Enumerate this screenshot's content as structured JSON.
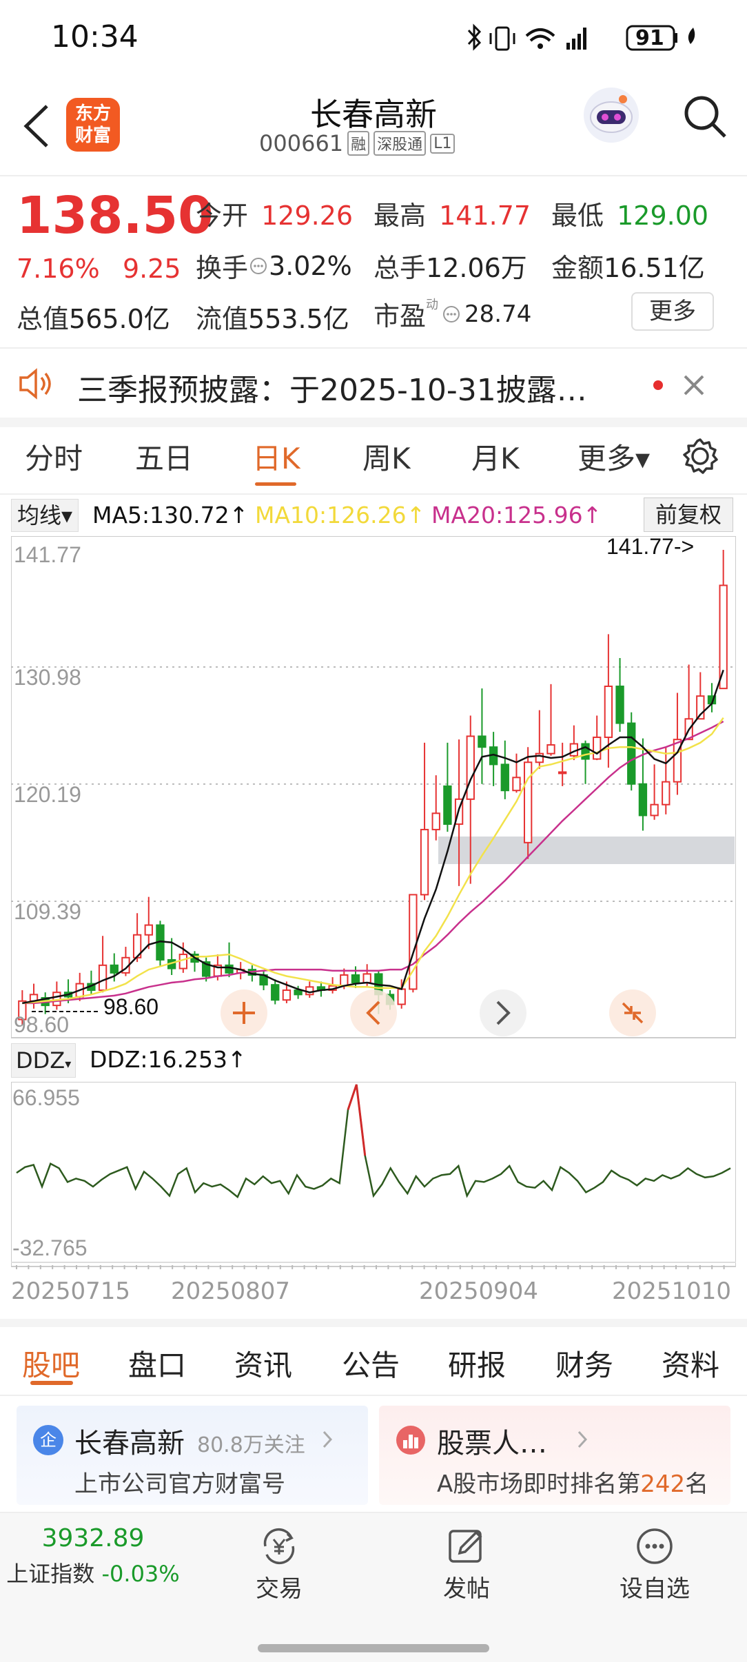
{
  "status_bar": {
    "time": "10:34",
    "battery": "91"
  },
  "header": {
    "logo_line1": "东方",
    "logo_line2": "财富",
    "title": "长春高新",
    "code": "000661",
    "tags": [
      "融",
      "深股通",
      "L1"
    ]
  },
  "quote": {
    "price": "138.50",
    "change_pct": "7.16%",
    "change_amt": "9.25",
    "open_label": "今开",
    "open": "129.26",
    "high_label": "最高",
    "high": "141.77",
    "low_label": "最低",
    "low": "129.00",
    "turnover_label": "换手",
    "turnover": "3.02%",
    "volume_label": "总手",
    "volume": "12.06万",
    "amount_label": "金额",
    "amount": "16.51亿",
    "mktcap_label": "总值",
    "mktcap": "565.0亿",
    "float_label": "流值",
    "float": "553.5亿",
    "pe_label": "市盈",
    "pe_sup": "动",
    "pe": "28.74",
    "more_label": "更多"
  },
  "notice": {
    "text": "三季报预披露：于2025-10-31披露…"
  },
  "period_tabs": [
    "分时",
    "五日",
    "日K",
    "周K",
    "月K",
    "更多▾"
  ],
  "active_period": "日K",
  "ma_bar": {
    "selector": "均线▾",
    "ma5": "MA5:130.72↑",
    "ma10": "MA10:126.26↑",
    "ma20": "MA20:125.96↑",
    "adjust": "前复权"
  },
  "colors": {
    "up": "#e63232",
    "down": "#1a9a2a",
    "ma5": "#111111",
    "ma10": "#f2e24a",
    "ma20": "#c8308c",
    "accent": "#e0692a"
  },
  "chart_data": {
    "type": "candlestick",
    "y_ticks": [
      "141.77",
      "130.98",
      "120.19",
      "109.39",
      "98.60"
    ],
    "ylim": [
      98.6,
      141.77
    ],
    "max_label": "141.77->",
    "min_label": "98.60",
    "x_ticks": [
      "20250715",
      "20250807",
      "20250904",
      "20251010"
    ],
    "candles": [
      [
        98.5,
        100.2,
        101.2,
        98.0
      ],
      [
        100.2,
        100.8,
        101.8,
        99.5
      ],
      [
        100.5,
        99.8,
        101.0,
        99.0
      ],
      [
        99.8,
        101.0,
        102.0,
        99.4
      ],
      [
        101.0,
        100.6,
        102.2,
        100.0
      ],
      [
        100.6,
        101.8,
        102.8,
        100.2
      ],
      [
        101.8,
        101.2,
        103.0,
        100.8
      ],
      [
        101.2,
        103.5,
        106.2,
        101.0
      ],
      [
        103.5,
        102.8,
        104.6,
        102.0
      ],
      [
        102.8,
        104.2,
        105.2,
        102.5
      ],
      [
        104.2,
        106.3,
        108.3,
        103.8
      ],
      [
        106.3,
        107.2,
        109.8,
        105.0
      ],
      [
        107.2,
        104.0,
        107.6,
        103.4
      ],
      [
        104.0,
        103.2,
        106.0,
        102.6
      ],
      [
        103.2,
        104.5,
        105.6,
        102.8
      ],
      [
        104.5,
        103.8,
        104.8,
        102.9
      ],
      [
        103.8,
        102.5,
        104.2,
        102.0
      ],
      [
        102.5,
        103.5,
        104.5,
        102.1
      ],
      [
        103.5,
        102.8,
        105.6,
        102.4
      ],
      [
        102.8,
        103.1,
        103.8,
        102.2
      ],
      [
        103.1,
        102.6,
        103.5,
        102.0
      ],
      [
        102.6,
        101.7,
        103.0,
        101.2
      ],
      [
        101.7,
        100.3,
        102.2,
        99.9
      ],
      [
        100.3,
        101.2,
        102.0,
        100.0
      ],
      [
        101.2,
        100.8,
        101.6,
        100.4
      ],
      [
        100.8,
        101.5,
        102.0,
        100.5
      ],
      [
        101.5,
        101.2,
        102.0,
        100.6
      ],
      [
        101.2,
        101.6,
        102.4,
        100.9
      ],
      [
        101.6,
        102.6,
        103.2,
        101.3
      ],
      [
        102.6,
        101.9,
        103.4,
        101.4
      ],
      [
        101.9,
        102.7,
        103.6,
        101.6
      ],
      [
        102.7,
        100.8,
        103.0,
        99.0
      ],
      [
        100.8,
        99.9,
        101.2,
        99.4
      ],
      [
        99.9,
        101.3,
        102.2,
        99.5
      ],
      [
        101.3,
        110.0,
        110.0,
        101.0
      ],
      [
        110.0,
        116.0,
        124.0,
        109.5
      ],
      [
        116.0,
        117.5,
        121.0,
        115.0
      ],
      [
        120.0,
        116.5,
        124.0,
        115.8
      ],
      [
        116.5,
        118.8,
        124.3,
        110.8
      ],
      [
        118.8,
        124.6,
        126.5,
        111.0
      ],
      [
        124.6,
        123.6,
        129.0,
        120.2
      ],
      [
        123.6,
        122.0,
        125.0,
        120.0
      ],
      [
        122.0,
        119.6,
        124.2,
        118.8
      ],
      [
        119.6,
        120.8,
        123.0,
        119.4
      ],
      [
        114.8,
        122.2,
        123.6,
        113.3
      ],
      [
        122.2,
        123.0,
        127.0,
        121.6
      ],
      [
        123.0,
        123.8,
        129.4,
        122.8
      ],
      [
        121.3,
        121.3,
        124.0,
        120.0
      ],
      [
        122.8,
        123.9,
        125.6,
        122.4
      ],
      [
        123.9,
        122.5,
        124.2,
        120.2
      ],
      [
        122.5,
        124.5,
        126.5,
        122.4
      ],
      [
        124.5,
        129.2,
        134.0,
        121.7
      ],
      [
        129.2,
        125.8,
        131.8,
        125.0
      ],
      [
        125.8,
        120.2,
        126.8,
        119.6
      ],
      [
        120.2,
        117.3,
        124.4,
        115.9
      ],
      [
        117.3,
        118.3,
        122.0,
        116.9
      ],
      [
        118.3,
        120.4,
        123.6,
        117.4
      ],
      [
        120.4,
        124.3,
        128.6,
        119.2
      ],
      [
        124.3,
        126.2,
        131.2,
        124.4
      ],
      [
        126.2,
        128.3,
        130.5,
        127.1
      ],
      [
        128.3,
        127.6,
        129.5,
        126.8
      ],
      [
        129.0,
        138.5,
        141.77,
        129.0
      ]
    ],
    "ma5": [
      100.0,
      100.2,
      100.4,
      100.6,
      100.8,
      101.2,
      101.6,
      102.1,
      102.5,
      103.2,
      104.3,
      105.4,
      105.7,
      105.6,
      105.0,
      104.2,
      103.6,
      103.3,
      103.3,
      103.1,
      102.7,
      102.6,
      102.1,
      101.7,
      101.3,
      101.0,
      101.2,
      101.3,
      101.6,
      101.8,
      101.9,
      101.7,
      101.6,
      101.3,
      104.6,
      107.8,
      110.5,
      114.0,
      117.9,
      120.6,
      122.7,
      122.9,
      122.6,
      122.2,
      122.7,
      122.8,
      122.6,
      122.7,
      123.2,
      123.6,
      123.0,
      123.8,
      124.5,
      124.5,
      123.6,
      122.5,
      122.1,
      123.1,
      125.2,
      126.6,
      127.6,
      130.7
    ],
    "ma10": [
      100.0,
      100.1,
      100.2,
      100.3,
      100.4,
      100.6,
      100.8,
      101.1,
      101.4,
      101.8,
      102.5,
      103.1,
      103.4,
      103.7,
      104.0,
      104.3,
      104.3,
      104.4,
      104.5,
      104.1,
      103.6,
      103.2,
      102.8,
      102.5,
      102.3,
      102.1,
      101.9,
      101.7,
      101.6,
      101.5,
      101.5,
      101.4,
      101.4,
      101.4,
      103.0,
      104.8,
      106.2,
      108.0,
      110.0,
      111.9,
      113.6,
      115.2,
      116.9,
      118.6,
      120.7,
      121.8,
      122.0,
      122.3,
      122.6,
      122.9,
      123.1,
      123.5,
      123.6,
      123.6,
      123.4,
      123.2,
      123.0,
      123.1,
      123.5,
      124.0,
      124.8,
      126.3
    ],
    "ma20": [
      100.0,
      100.0,
      100.1,
      100.2,
      100.3,
      100.4,
      100.5,
      100.6,
      100.7,
      100.9,
      101.2,
      101.5,
      101.7,
      101.9,
      102.0,
      102.2,
      102.3,
      102.5,
      102.6,
      102.8,
      102.9,
      103.0,
      103.1,
      103.1,
      103.1,
      103.1,
      103.1,
      103.0,
      103.0,
      103.0,
      103.0,
      103.0,
      103.1,
      103.1,
      103.6,
      104.5,
      105.3,
      106.3,
      107.4,
      108.4,
      109.3,
      110.3,
      111.3,
      112.4,
      113.5,
      114.6,
      115.7,
      116.8,
      117.8,
      118.8,
      119.8,
      120.8,
      121.7,
      122.4,
      122.9,
      123.3,
      123.6,
      124.0,
      124.4,
      124.9,
      125.4,
      125.96
    ],
    "ddz_name": "DDZ",
    "ddz_value": "DDZ:16.253↑",
    "ddz_ylim": [
      -32.765,
      66.955
    ],
    "ddz_ticks": [
      "66.955",
      "-32.765"
    ],
    "ddz": [
      -10.0,
      -5.0,
      -3.0,
      -22.0,
      -2.0,
      -6.0,
      -18.0,
      -15.0,
      -17.0,
      -22.0,
      -16.0,
      -11.0,
      -8.0,
      -5.0,
      -24.0,
      -9.0,
      -15.0,
      -22.0,
      -30.0,
      -11.0,
      -6.0,
      -27.0,
      -19.0,
      -22.0,
      -20.0,
      -25.0,
      -31.0,
      -15.0,
      -20.0,
      -13.0,
      -19.0,
      -17.0,
      -28.0,
      -12.0,
      -22.0,
      -24.0,
      -21.0,
      -15.0,
      -19.0,
      45.0,
      66.955,
      5.0,
      -30.0,
      -20.0,
      -6.0,
      -18.0,
      -28.0,
      -13.0,
      -22.0,
      -15.0,
      -12.0,
      -11.0,
      -4.0,
      -30.0,
      -17.0,
      -18.0,
      -15.0,
      -11.0,
      -4.0,
      -18.0,
      -22.0,
      -23.0,
      -17.0,
      -25.0,
      -5.0,
      -10.0,
      -17.0,
      -27.0,
      -23.0,
      -18.0,
      -8.0,
      -13.0,
      -16.0,
      -21.0,
      -15.0,
      -17.0,
      -12.0,
      -15.0,
      -12.0,
      -6.0,
      -11.0,
      -14.0,
      -13.0,
      -10.0,
      -6.0
    ]
  },
  "bottom_tabs": [
    "股吧",
    "盘口",
    "资讯",
    "公告",
    "研报",
    "财务",
    "资料"
  ],
  "active_bottom_tab": "股吧",
  "cards": {
    "left_badge": "企",
    "left_title": "长春高新",
    "left_follow": "80.8万关注",
    "left_sub": "上市公司官方财富号",
    "right_title": "股票人…",
    "right_sub_prefix": "A股市场即时排名第",
    "right_rank": "242",
    "right_sub_suffix": "名"
  },
  "bottom_nav": {
    "index_value": "3932.89",
    "index_name": "上证指数",
    "index_change": "-0.03%",
    "trade": "交易",
    "post": "发帖",
    "watch": "设自选"
  }
}
